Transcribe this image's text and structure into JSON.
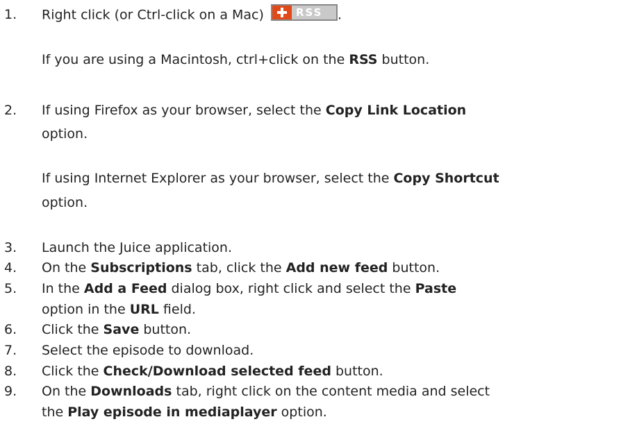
{
  "steps": [
    {
      "number": "1.",
      "text_before": "Right click (or Ctrl-click on a Mac)",
      "text_after": ".",
      "icon": "rss-add-button",
      "icon_label": "RSS",
      "note": {
        "t1": "If you are using a Macintosh, ctrl+click on the ",
        "b1": "RSS",
        "t2": " button."
      }
    },
    {
      "number": "2.",
      "lines": [
        {
          "t1": "If using Firefox as your browser, select the ",
          "b1": "Copy Link Location"
        },
        {
          "t1": "option."
        }
      ],
      "note_lines": [
        {
          "t1": "If using Internet Explorer as your browser, select the ",
          "b1": "Copy Shortcut"
        },
        {
          "t1": "option."
        }
      ]
    },
    {
      "number": "3.",
      "t1": "Launch the Juice application."
    },
    {
      "number": "4.",
      "t1": "On the ",
      "b1": "Subscriptions",
      "t2": " tab, click the ",
      "b2": "Add new feed",
      "t3": " button."
    },
    {
      "number": "5.",
      "line1": {
        "t1": "In the ",
        "b1": "Add a Feed",
        "t2": " dialog box, right click and select the ",
        "b2": "Paste"
      },
      "line2": {
        "t1": "option in the ",
        "b1": "URL",
        "t2": " field."
      }
    },
    {
      "number": "6.",
      "t1": "Click the ",
      "b1": "Save",
      "t2": " button."
    },
    {
      "number": "7.",
      "t1": "Select the episode to download."
    },
    {
      "number": "8.",
      "t1": "Click the ",
      "b1": "Check/Download selected feed",
      "t2": " button."
    },
    {
      "number": "9.",
      "line1": {
        "t1": "On the ",
        "b1": "Downloads",
        "t2": " tab, right click on the content media and select"
      },
      "line2": {
        "t1": "the ",
        "b1": "Play episode in mediaplayer",
        "t2": " option."
      }
    }
  ]
}
